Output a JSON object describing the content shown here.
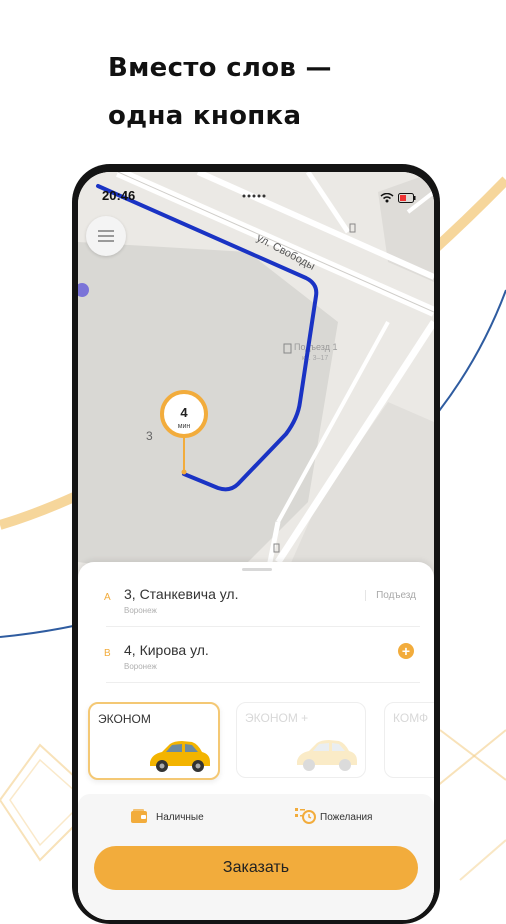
{
  "headline": {
    "line1": "Вместо слов —",
    "line2": "одна кнопка"
  },
  "status": {
    "time": "20:46"
  },
  "map": {
    "street_label": "ул. Свободы",
    "building_number": "3",
    "entrance_label": "Подъезд 1",
    "entrance_sub": "кв. 3–17",
    "eta_value": "4",
    "eta_unit": "мин"
  },
  "route": {
    "from": {
      "letter": "A",
      "address": "3, Станкевича ул.",
      "city": "Воронеж",
      "extra": "Подъезд"
    },
    "to": {
      "letter": "B",
      "address": "4, Кирова ул.",
      "city": "Воронеж"
    }
  },
  "tariffs": [
    {
      "name": "ЭКОНОМ",
      "selected": true
    },
    {
      "name": "ЭКОНОМ +",
      "selected": false
    },
    {
      "name": "КОМФ",
      "selected": false
    }
  ],
  "payment": {
    "label": "Наличные",
    "icon": "wallet-icon"
  },
  "wishes": {
    "label": "Пожелания",
    "icon": "wishes-list-icon"
  },
  "order_button": {
    "label": "Заказать"
  },
  "colors": {
    "accent": "#f2ac3c",
    "route": "#1a33c4",
    "decor_line_blue": "#2f5ca0",
    "decor_line_gold": "#f4cf8a"
  }
}
